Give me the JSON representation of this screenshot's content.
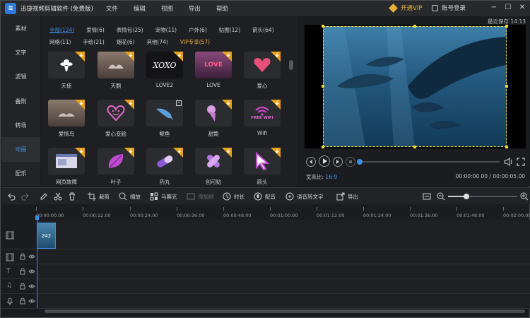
{
  "app": {
    "title": "迅捷视频剪辑软件 (免费版)",
    "logo_glyph": "≋",
    "menu": [
      "文件",
      "编辑",
      "视图",
      "导出",
      "帮助"
    ],
    "vip_label": "开通VIP",
    "account_label": "账号登录",
    "accent": "#3d8eea",
    "vip_color": "#e8b13a"
  },
  "leftnav": {
    "items": [
      "素材",
      "文字",
      "滤镜",
      "叠附",
      "转场",
      "动画",
      "配乐"
    ],
    "active": "动画"
  },
  "assets": {
    "tags_row1": [
      "全部(124)",
      "爱情(6)",
      "表情包(25)",
      "宠物(11)",
      "户外(6)",
      "贴图(12)",
      "箭头(64)"
    ],
    "tags_row2": [
      "网络(11)",
      "手绘(21)",
      "烟花(6)",
      "其他(74)",
      "VIP专享(57)"
    ],
    "items": [
      {
        "label": "天使",
        "icon": "angel-icon",
        "bg": "#2b2c30"
      },
      {
        "label": "天鹅",
        "icon": "swan-scene",
        "bg": "#6b5a4e"
      },
      {
        "label": "LOVE2",
        "icon": "xoxo-text",
        "bg": "#141416",
        "text": "XOXO"
      },
      {
        "label": "LOVE",
        "icon": "love-text",
        "bg": "#6d3c6a",
        "text": "LOVE"
      },
      {
        "label": "爱心",
        "icon": "heart-icon",
        "bg": "#2b2c30"
      },
      {
        "label": "爱情鸟",
        "icon": "lovebird-scene",
        "bg": "#6b5a4e"
      },
      {
        "label": "爱心变脸",
        "icon": "heart-face-icon",
        "bg": "#2b2c30"
      },
      {
        "label": "鲸鱼",
        "icon": "whale-icon",
        "bg": "#2b2c30"
      },
      {
        "label": "甜筒",
        "icon": "icecream-icon",
        "bg": "#2b2c30"
      },
      {
        "label": "Wifi",
        "icon": "wifi-icon",
        "bg": "#2b2c30",
        "text": "FREE WIFI"
      },
      {
        "label": "网页故障",
        "icon": "webpage-icon",
        "bg": "#2b2c30"
      },
      {
        "label": "叶子",
        "icon": "leaf-icon",
        "bg": "#2b2c30"
      },
      {
        "label": "药丸",
        "icon": "pill-icon",
        "bg": "#2b2c30"
      },
      {
        "label": "创可贴",
        "icon": "bandage-icon",
        "bg": "#2b2c30"
      },
      {
        "label": "箭头",
        "icon": "cursor-arrow-icon",
        "bg": "#2b2c30"
      }
    ]
  },
  "preview": {
    "save_status": "最近保存 14:13",
    "ratio_label": "宽高比:",
    "ratio_value": "16:9",
    "time": "00:00:00.00 / 00:00:05.00",
    "progress": 0
  },
  "timeline": {
    "tools": [
      {
        "label": "裁剪",
        "icon": "crop-icon",
        "enabled": true
      },
      {
        "label": "缩放",
        "icon": "zoom-icon",
        "enabled": true
      },
      {
        "label": "马赛克",
        "icon": "mosaic-icon",
        "enabled": true
      },
      {
        "label": "添加帧",
        "icon": "add-frame-icon",
        "enabled": false
      },
      {
        "label": "时长",
        "icon": "clock-icon",
        "enabled": true
      },
      {
        "label": "配音",
        "icon": "mic-icon",
        "enabled": true
      },
      {
        "label": "语音转文字",
        "icon": "speech-to-text-icon",
        "enabled": true
      },
      {
        "label": "导出",
        "icon": "export-icon",
        "enabled": true
      }
    ],
    "zoom_level": 0.27,
    "ruler": [
      "00:00:00.00",
      "00:00:12.00",
      "00:00:24.00",
      "00:00:36.00",
      "00:00:48.00",
      "00:01:00.00",
      "00:01:12.00",
      "00:01:24.00",
      "00:01:36.00",
      "00:01:48.00",
      "00:02:00.00"
    ],
    "clip_label": "242"
  }
}
